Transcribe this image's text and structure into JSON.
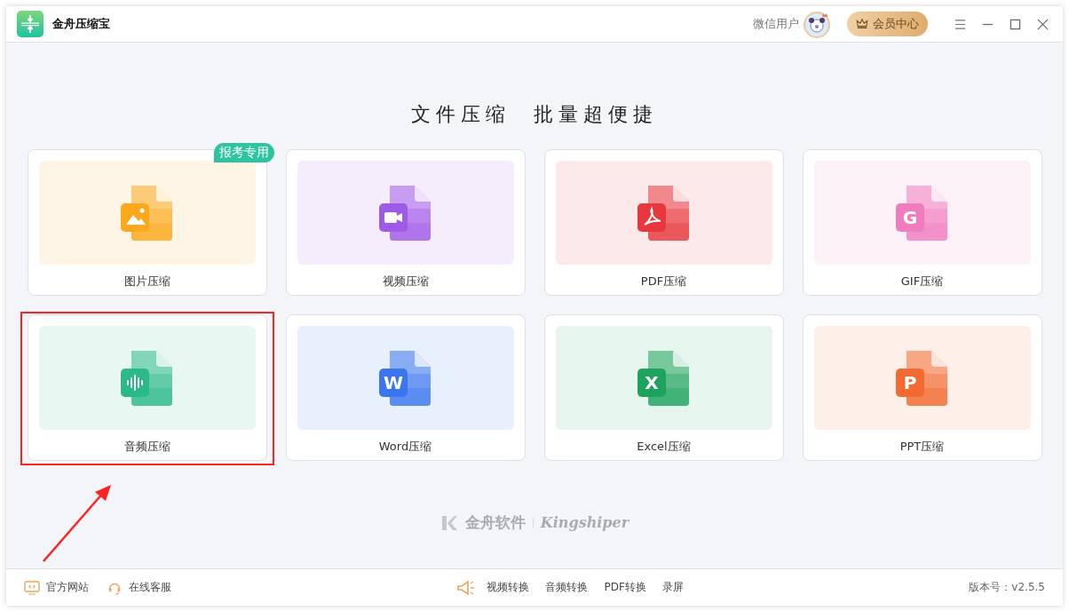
{
  "window": {
    "title": "金舟压缩宝"
  },
  "account": {
    "username": "微信用户",
    "member_button": "会员中心"
  },
  "headline": "文件压缩  批量超便捷",
  "tools": [
    {
      "kind": "image",
      "label": "图片压缩",
      "color": "#fba81c",
      "badge": "报考专用",
      "highlighted": false
    },
    {
      "kind": "video",
      "label": "视频压缩",
      "color": "#a05ae8",
      "highlighted": false
    },
    {
      "kind": "pdf",
      "label": "PDF压缩",
      "color": "#e8383d",
      "highlighted": false
    },
    {
      "kind": "gif",
      "label": "GIF压缩",
      "color": "#f07cc0",
      "glyph": "G",
      "highlighted": false
    },
    {
      "kind": "audio",
      "label": "音频压缩",
      "color": "#2bb98a",
      "highlighted": true
    },
    {
      "kind": "word",
      "label": "Word压缩",
      "color": "#3a76ee",
      "glyph": "W",
      "highlighted": false
    },
    {
      "kind": "excel",
      "label": "Excel压缩",
      "color": "#1ea35c",
      "glyph": "X",
      "highlighted": false
    },
    {
      "kind": "ppt",
      "label": "PPT压缩",
      "color": "#f26a30",
      "glyph": "P",
      "highlighted": false
    }
  ],
  "brand": {
    "name": "金舟软件",
    "latin": "Kingshiper"
  },
  "footer": {
    "left": [
      {
        "kind": "website",
        "label": "官方网站"
      },
      {
        "kind": "support",
        "label": "在线客服"
      }
    ],
    "links": [
      "视频转换",
      "音频转换",
      "PDF转换",
      "录屏"
    ],
    "version": "版本号：v2.5.5"
  }
}
